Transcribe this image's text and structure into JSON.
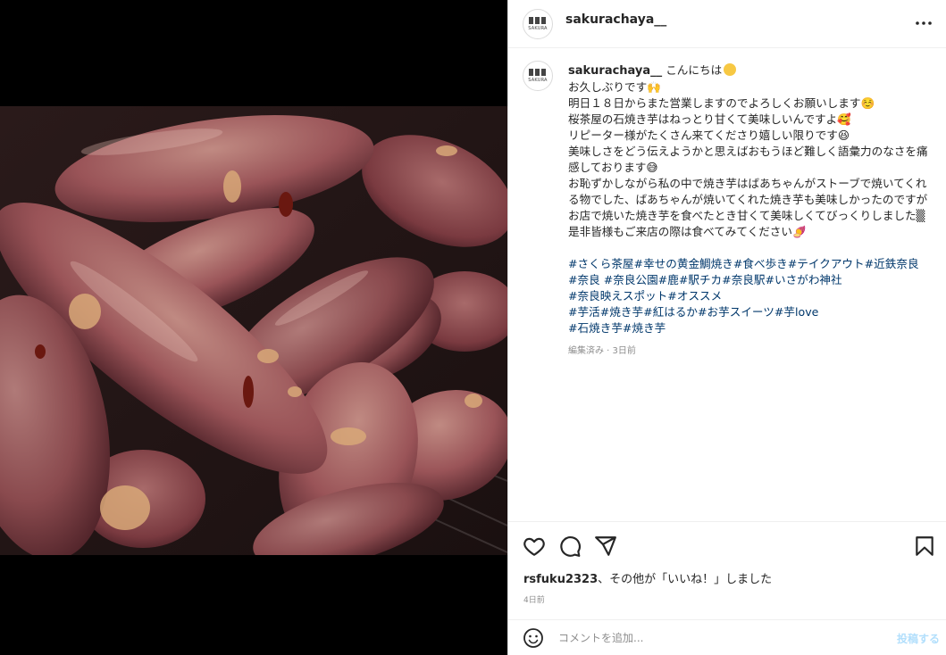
{
  "post": {
    "username": "sakurachaya__",
    "avatar_text": "SAKURA",
    "caption": {
      "first_line": "こんにちは",
      "lines": [
        "お久しぶりです🙌",
        "明日１８日からまた営業しますのでよろしくお願いします☺️",
        "桜茶屋の石焼き芋はねっとり甘くて美味しいんですよ🥰",
        "リピーター様がたくさん来てくださり嬉しい限りです😆",
        "美味しさをどう伝えようかと思えばおもうほど難しく語彙力のなさを痛感しております😅",
        "お恥ずかしながら私の中で焼き芋はばあちゃんがストーブで焼いてくれる物でした、ばあちゃんが焼いてくれた焼き芋も美味しかったのですがお店で焼いた焼き芋を食べたとき甘くて美味しくてびっくりしました▒",
        "是非皆様もご来店の際は食べてみてください🍠"
      ],
      "hashtag_lines": [
        "#さくら茶屋#幸せの黄金鯛焼き#食べ歩き#テイクアウト#近鉄奈良",
        "#奈良 #奈良公園#鹿#駅チカ#奈良駅#いさがわ神社",
        "#奈良映えスポット#オススメ",
        "#芋活#焼き芋#紅はるか#お芋スイーツ#芋love",
        "#石焼き芋#焼き芋"
      ],
      "meta": "編集済み · 3日前"
    },
    "likes_user": "rsfuku2323",
    "likes_rest": "、その他が「いいね！」しました",
    "time_ago": "4日前",
    "comment_placeholder": "コメントを追加...",
    "post_label": "投稿する",
    "icons": [
      "more-icon",
      "heart-icon",
      "comment-icon",
      "share-icon",
      "bookmark-icon",
      "emoji-icon"
    ]
  }
}
